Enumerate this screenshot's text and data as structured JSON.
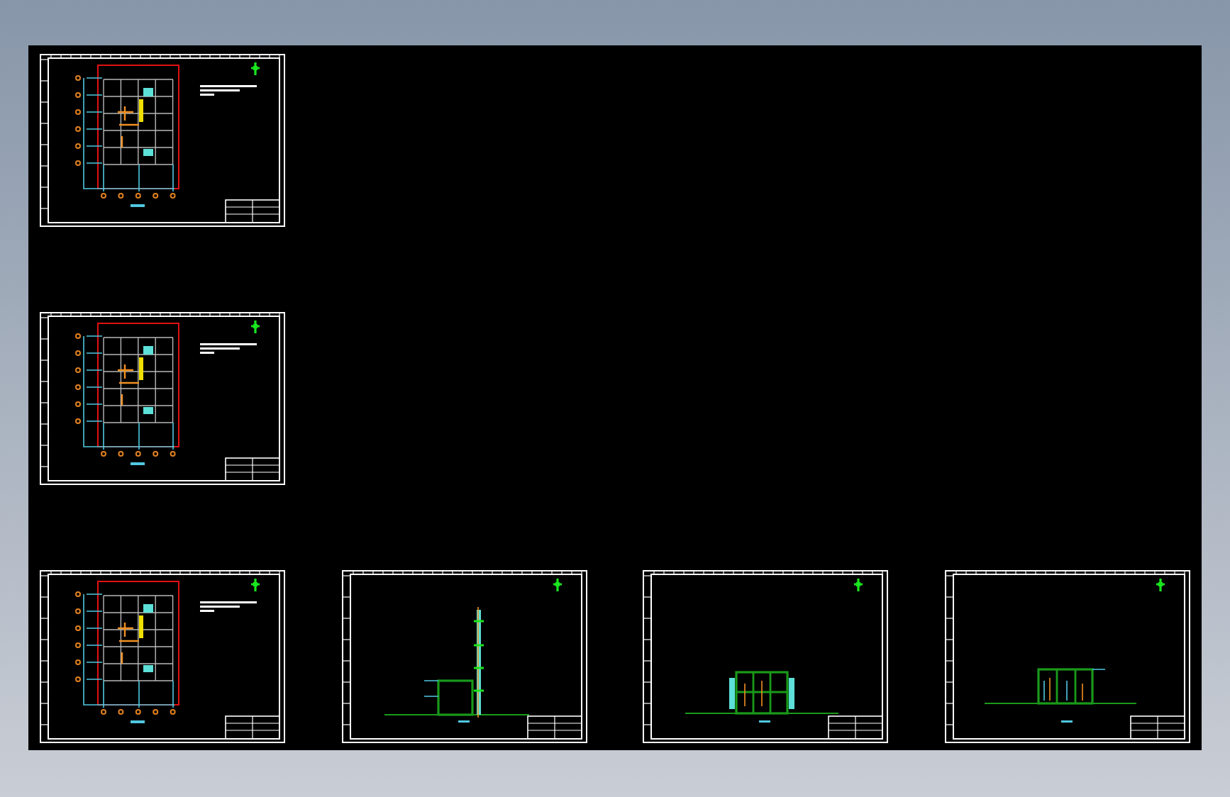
{
  "drawing_sheets": [
    {
      "kind": "floor_plan"
    },
    {
      "kind": "floor_plan"
    },
    {
      "kind": "floor_plan"
    },
    {
      "kind": "tower_elevation"
    },
    {
      "kind": "section_elevation"
    },
    {
      "kind": "wide_elevation"
    }
  ]
}
